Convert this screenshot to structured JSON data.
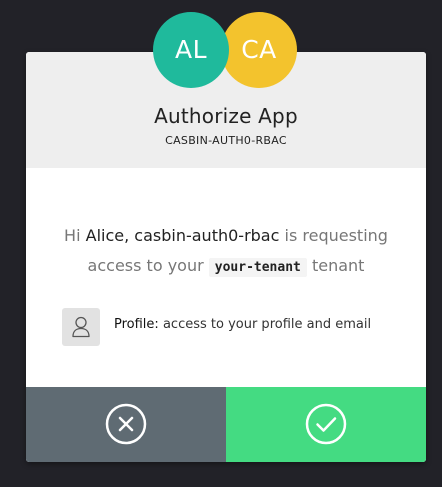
{
  "avatars": {
    "user_initials": "AL",
    "app_initials": "CA",
    "user_color": "#1fba9c",
    "app_color": "#f3c32d"
  },
  "header": {
    "title": "Authorize App",
    "subtitle": "CASBIN-AUTH0-RBAC"
  },
  "message": {
    "greeting": "Hi",
    "user_name": "Alice",
    "app_name": "casbin-auth0-rbac",
    "requesting": "is requesting",
    "access_to": "access to your",
    "tenant_code": "your-tenant",
    "tenant_word": "tenant"
  },
  "scopes": [
    {
      "icon": "user-icon",
      "name": "Profile:",
      "description": "access to your profile and email"
    }
  ],
  "buttons": {
    "deny_icon": "close-circle-icon",
    "accept_icon": "check-circle-icon",
    "deny_color": "#5f6b73",
    "accept_color": "#44db82"
  }
}
